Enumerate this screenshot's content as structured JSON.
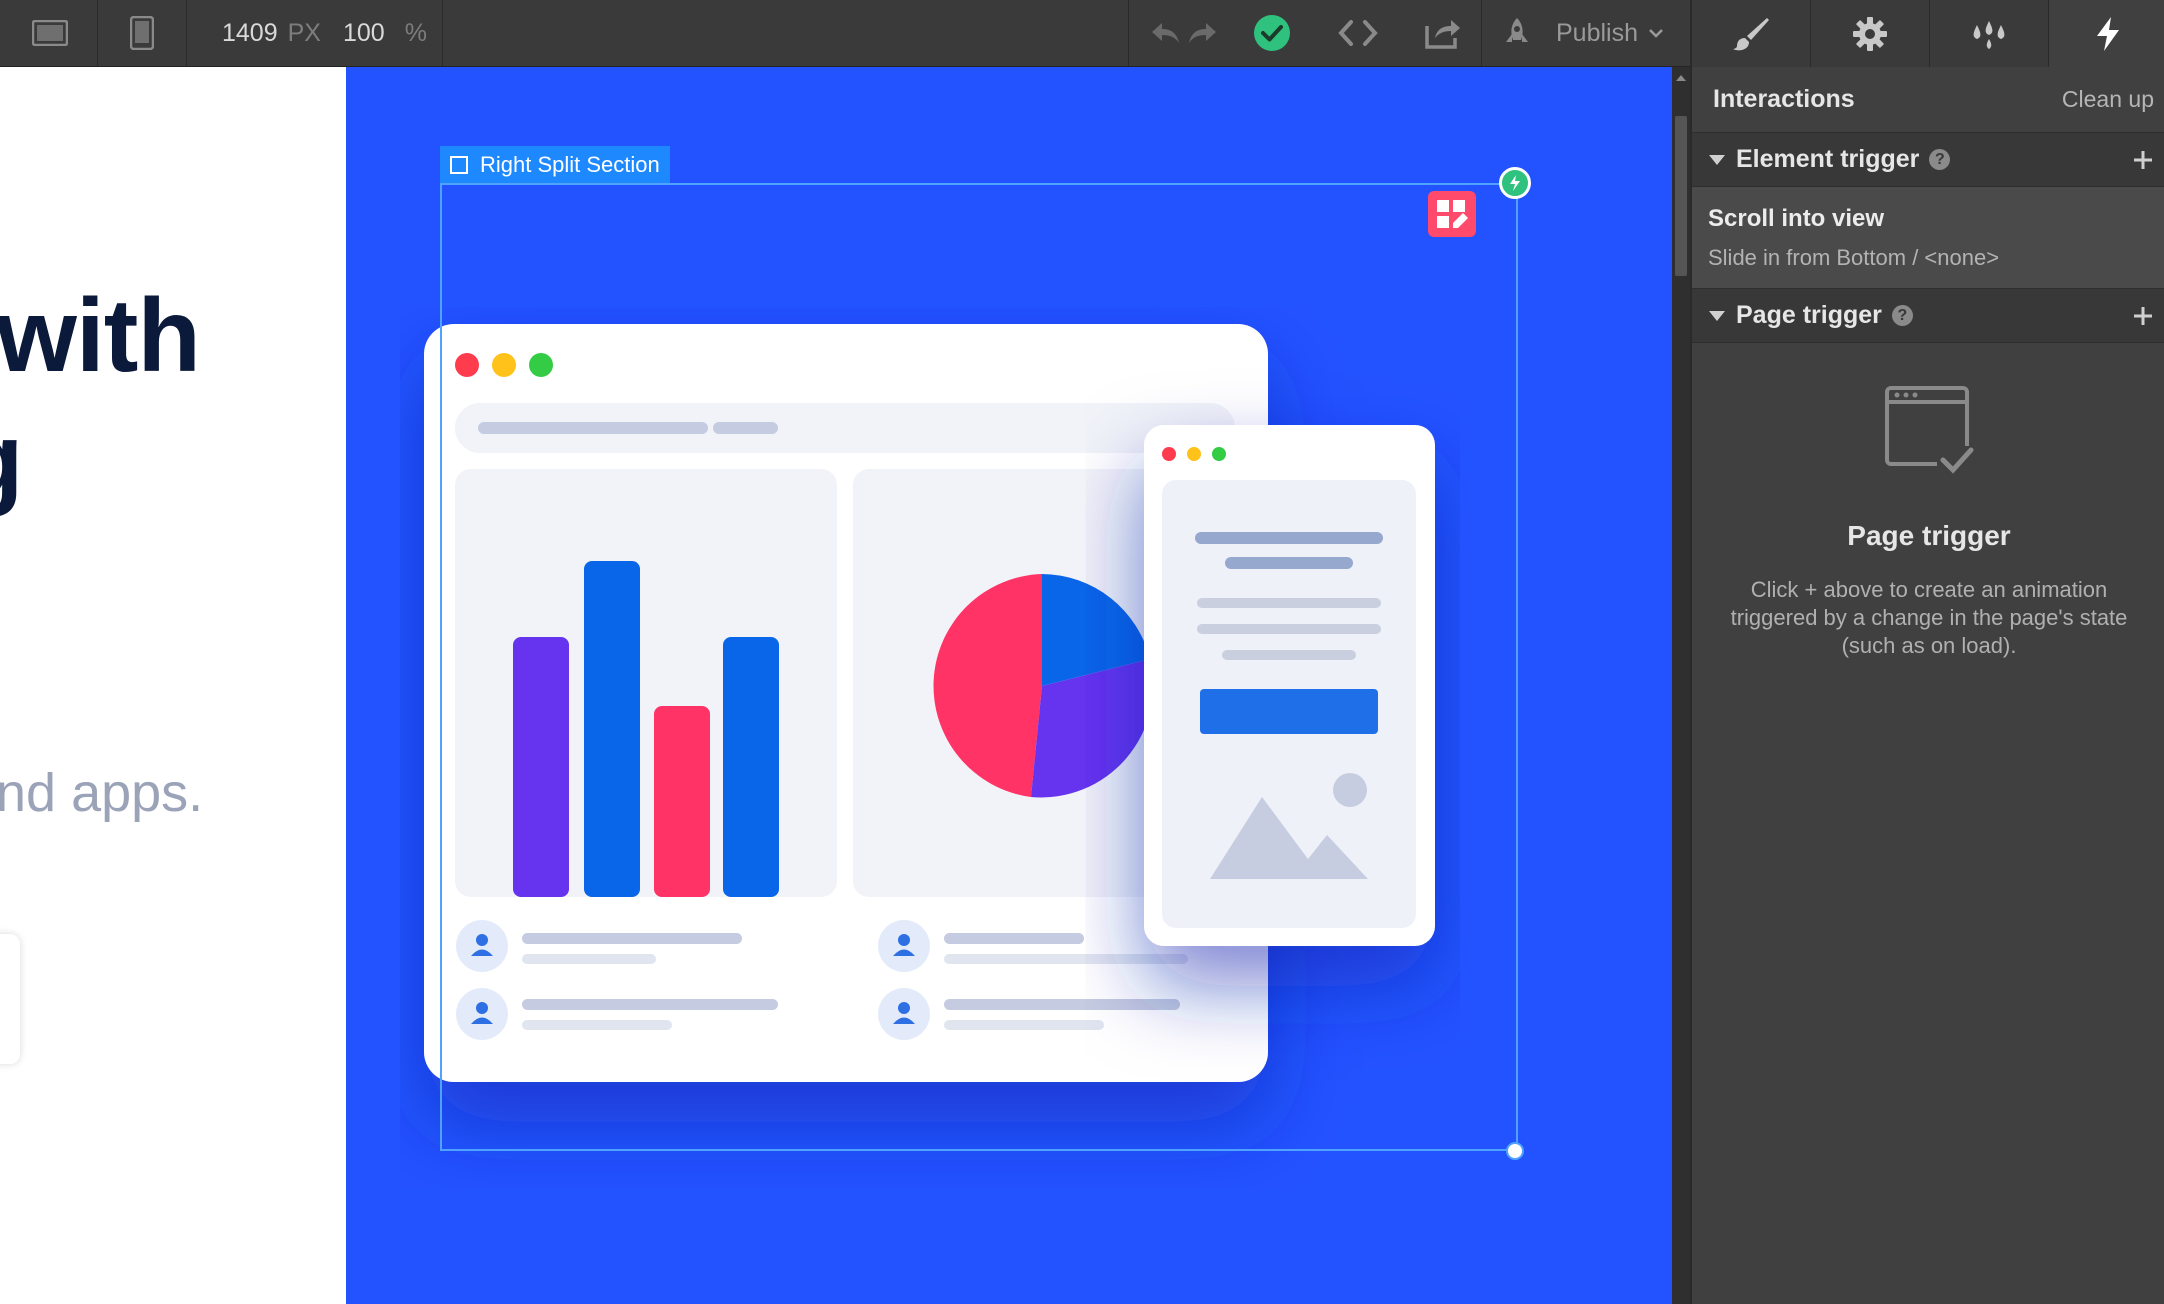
{
  "toolbar": {
    "width_value": "1409",
    "width_unit": "PX",
    "zoom_value": "100",
    "zoom_unit": "%",
    "publish_label": "Publish"
  },
  "canvas": {
    "hero_line1": "with",
    "hero_line2": "g",
    "hero_sub": "nd apps.",
    "selection_label": "Right Split Section"
  },
  "panel": {
    "title": "Interactions",
    "cleanup_label": "Clean up",
    "element_trigger_label": "Element trigger",
    "scroll_item_title": "Scroll into view",
    "scroll_item_sub": "Slide in from Bottom / <none>",
    "page_trigger_label": "Page trigger",
    "empty_title": "Page trigger",
    "empty_desc": "Click + above to create an animation triggered by a change in the page's state (such as on load)."
  },
  "colors": {
    "canvas_blue": "#2353ff",
    "selection": "#4fa3ff",
    "publish_ok": "#2ec27e",
    "bar_purple": "#6633ee",
    "bar_blue": "#0a66e8",
    "bar_pink": "#ff3366"
  }
}
